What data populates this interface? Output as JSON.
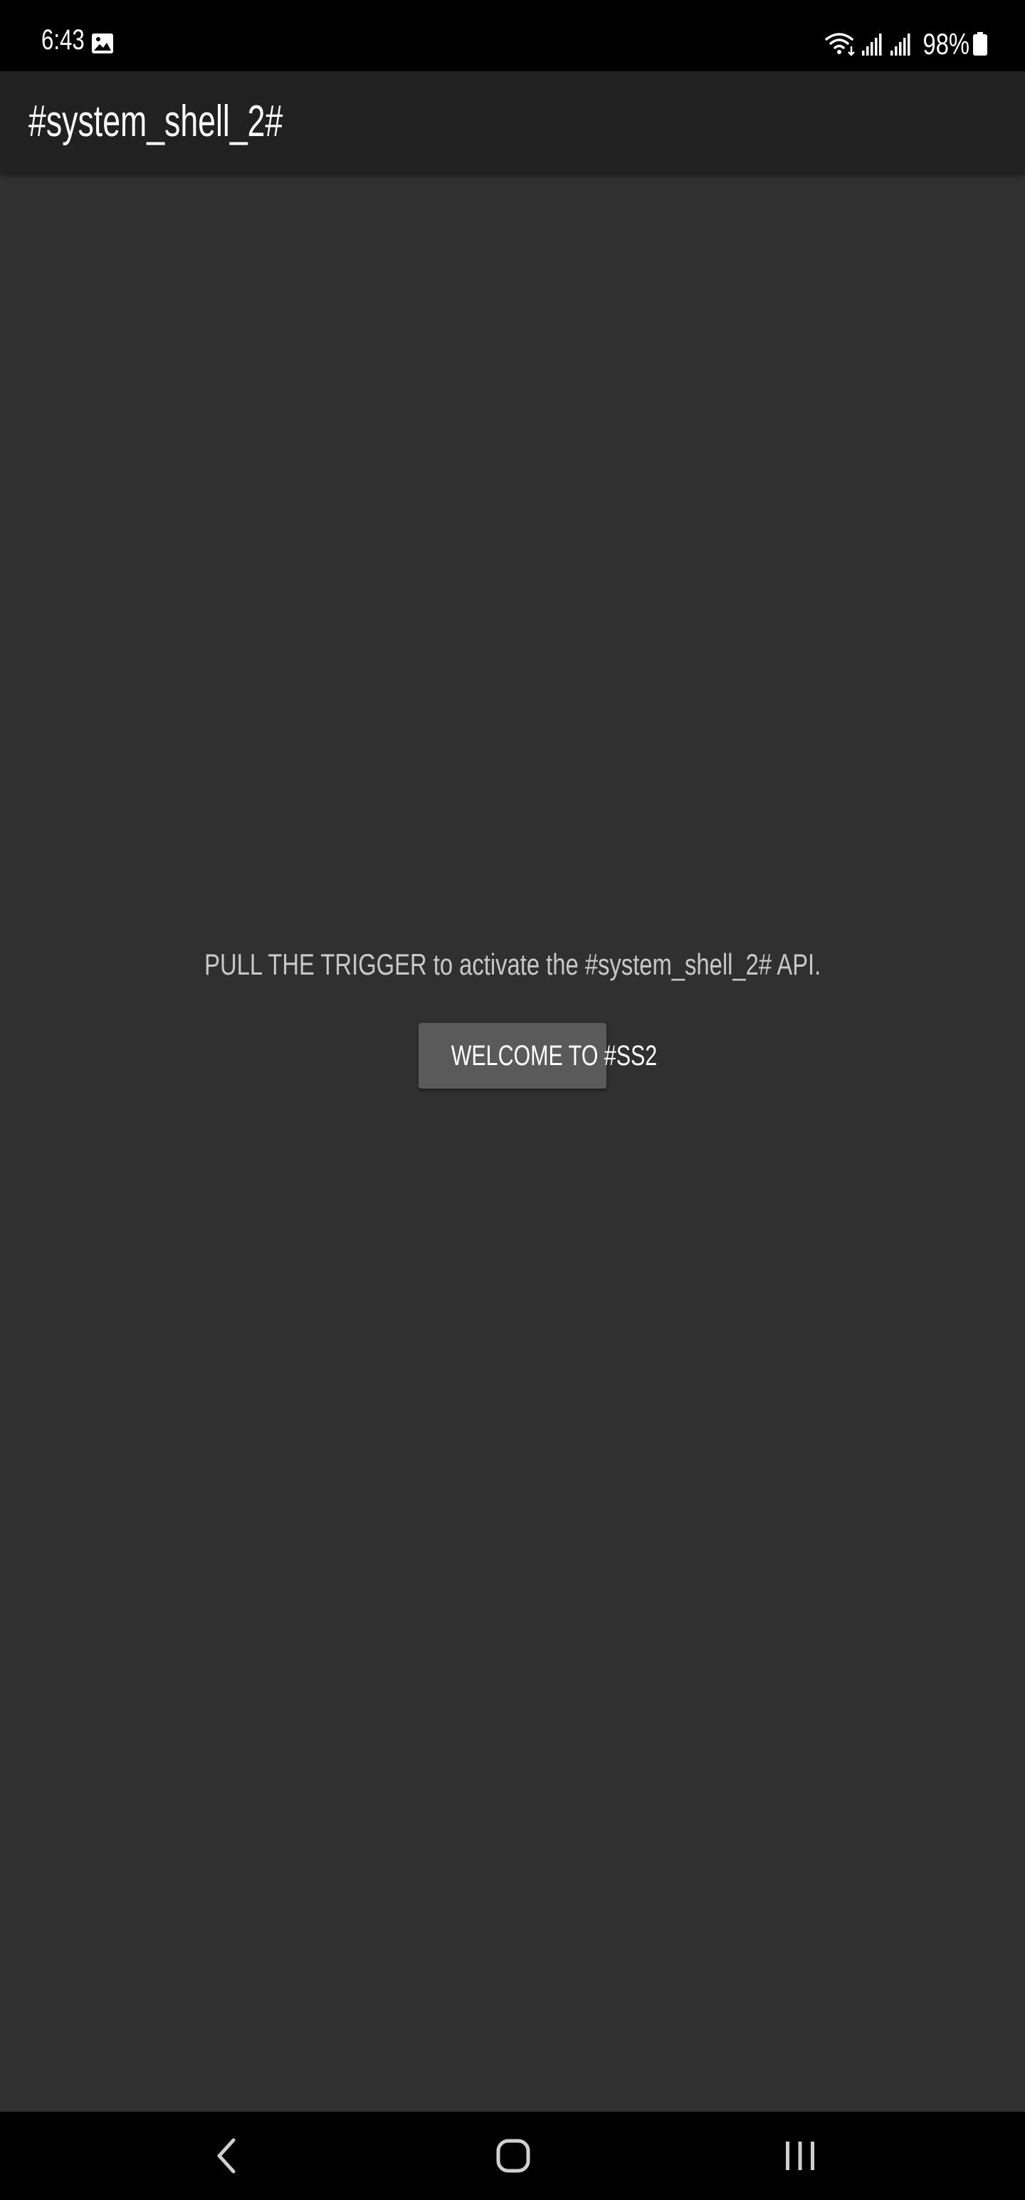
{
  "status_bar": {
    "time": "6:43",
    "battery": "98%",
    "icons": [
      "image-notification-icon",
      "wifi-icon",
      "signal-icon",
      "signal-icon",
      "battery-icon"
    ]
  },
  "app_bar": {
    "title": "#system_shell_2#"
  },
  "main": {
    "prompt": "PULL THE TRIGGER to activate the #system_shell_2# API.",
    "button_label": "WELCOME TO #SS2"
  },
  "nav_bar": {
    "icons": [
      "back-icon",
      "home-icon",
      "recents-icon"
    ]
  },
  "colors": {
    "background": "#303030",
    "app_bar": "#212121",
    "button": "#5a5a5a",
    "system_bars": "#000000",
    "prompt_text": "#c8c8c8"
  }
}
